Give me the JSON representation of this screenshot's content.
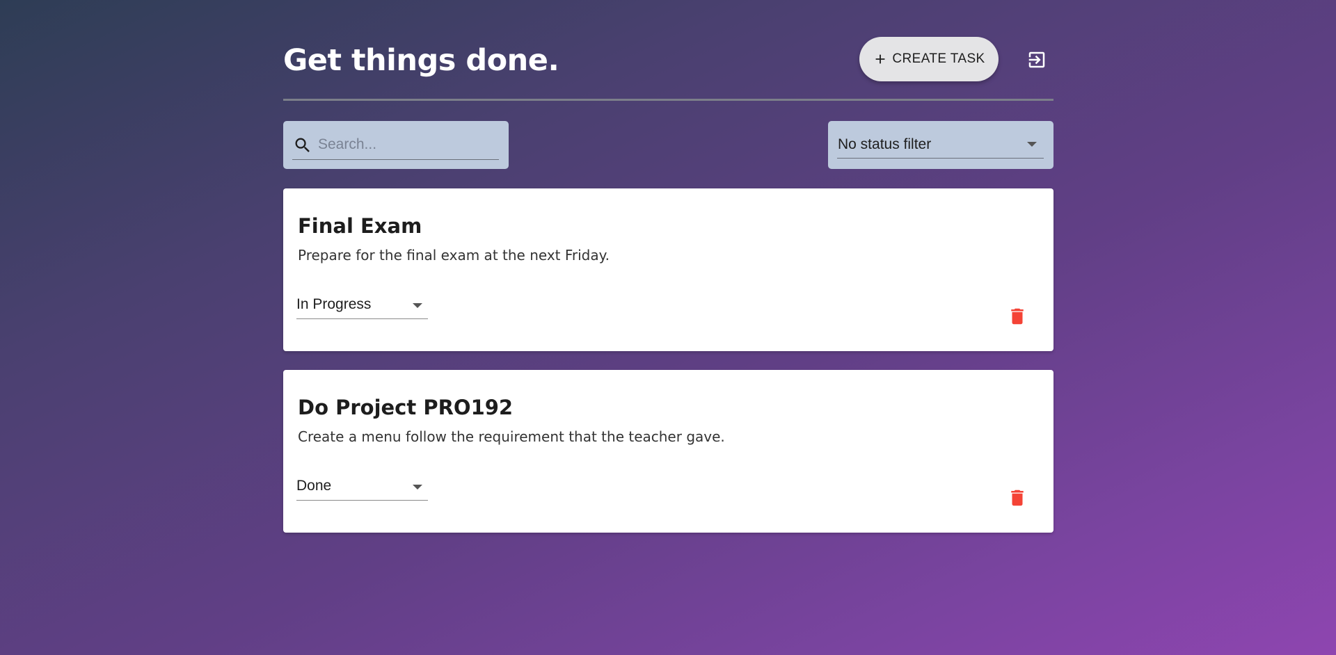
{
  "header": {
    "title": "Get things done.",
    "create_label": "CREATE TASK"
  },
  "search": {
    "placeholder": "Search...",
    "value": ""
  },
  "filter": {
    "value": "No status filter"
  },
  "tasks": [
    {
      "title": "Final Exam",
      "description": "Prepare for the final exam at the next Friday.",
      "status": "In Progress"
    },
    {
      "title": "Do Project PRO192",
      "description": "Create a menu follow the requirement that the teacher gave.",
      "status": "Done"
    }
  ],
  "icons": {
    "create": "plus-icon",
    "logout": "logout-icon",
    "search": "search-icon",
    "delete": "trash-icon",
    "dropdown": "caret-down-icon"
  },
  "colors": {
    "delete_icon": "#f44336",
    "input_background": "#bdcadd",
    "card_background": "#ffffff",
    "button_background": "#e4e4e6"
  }
}
